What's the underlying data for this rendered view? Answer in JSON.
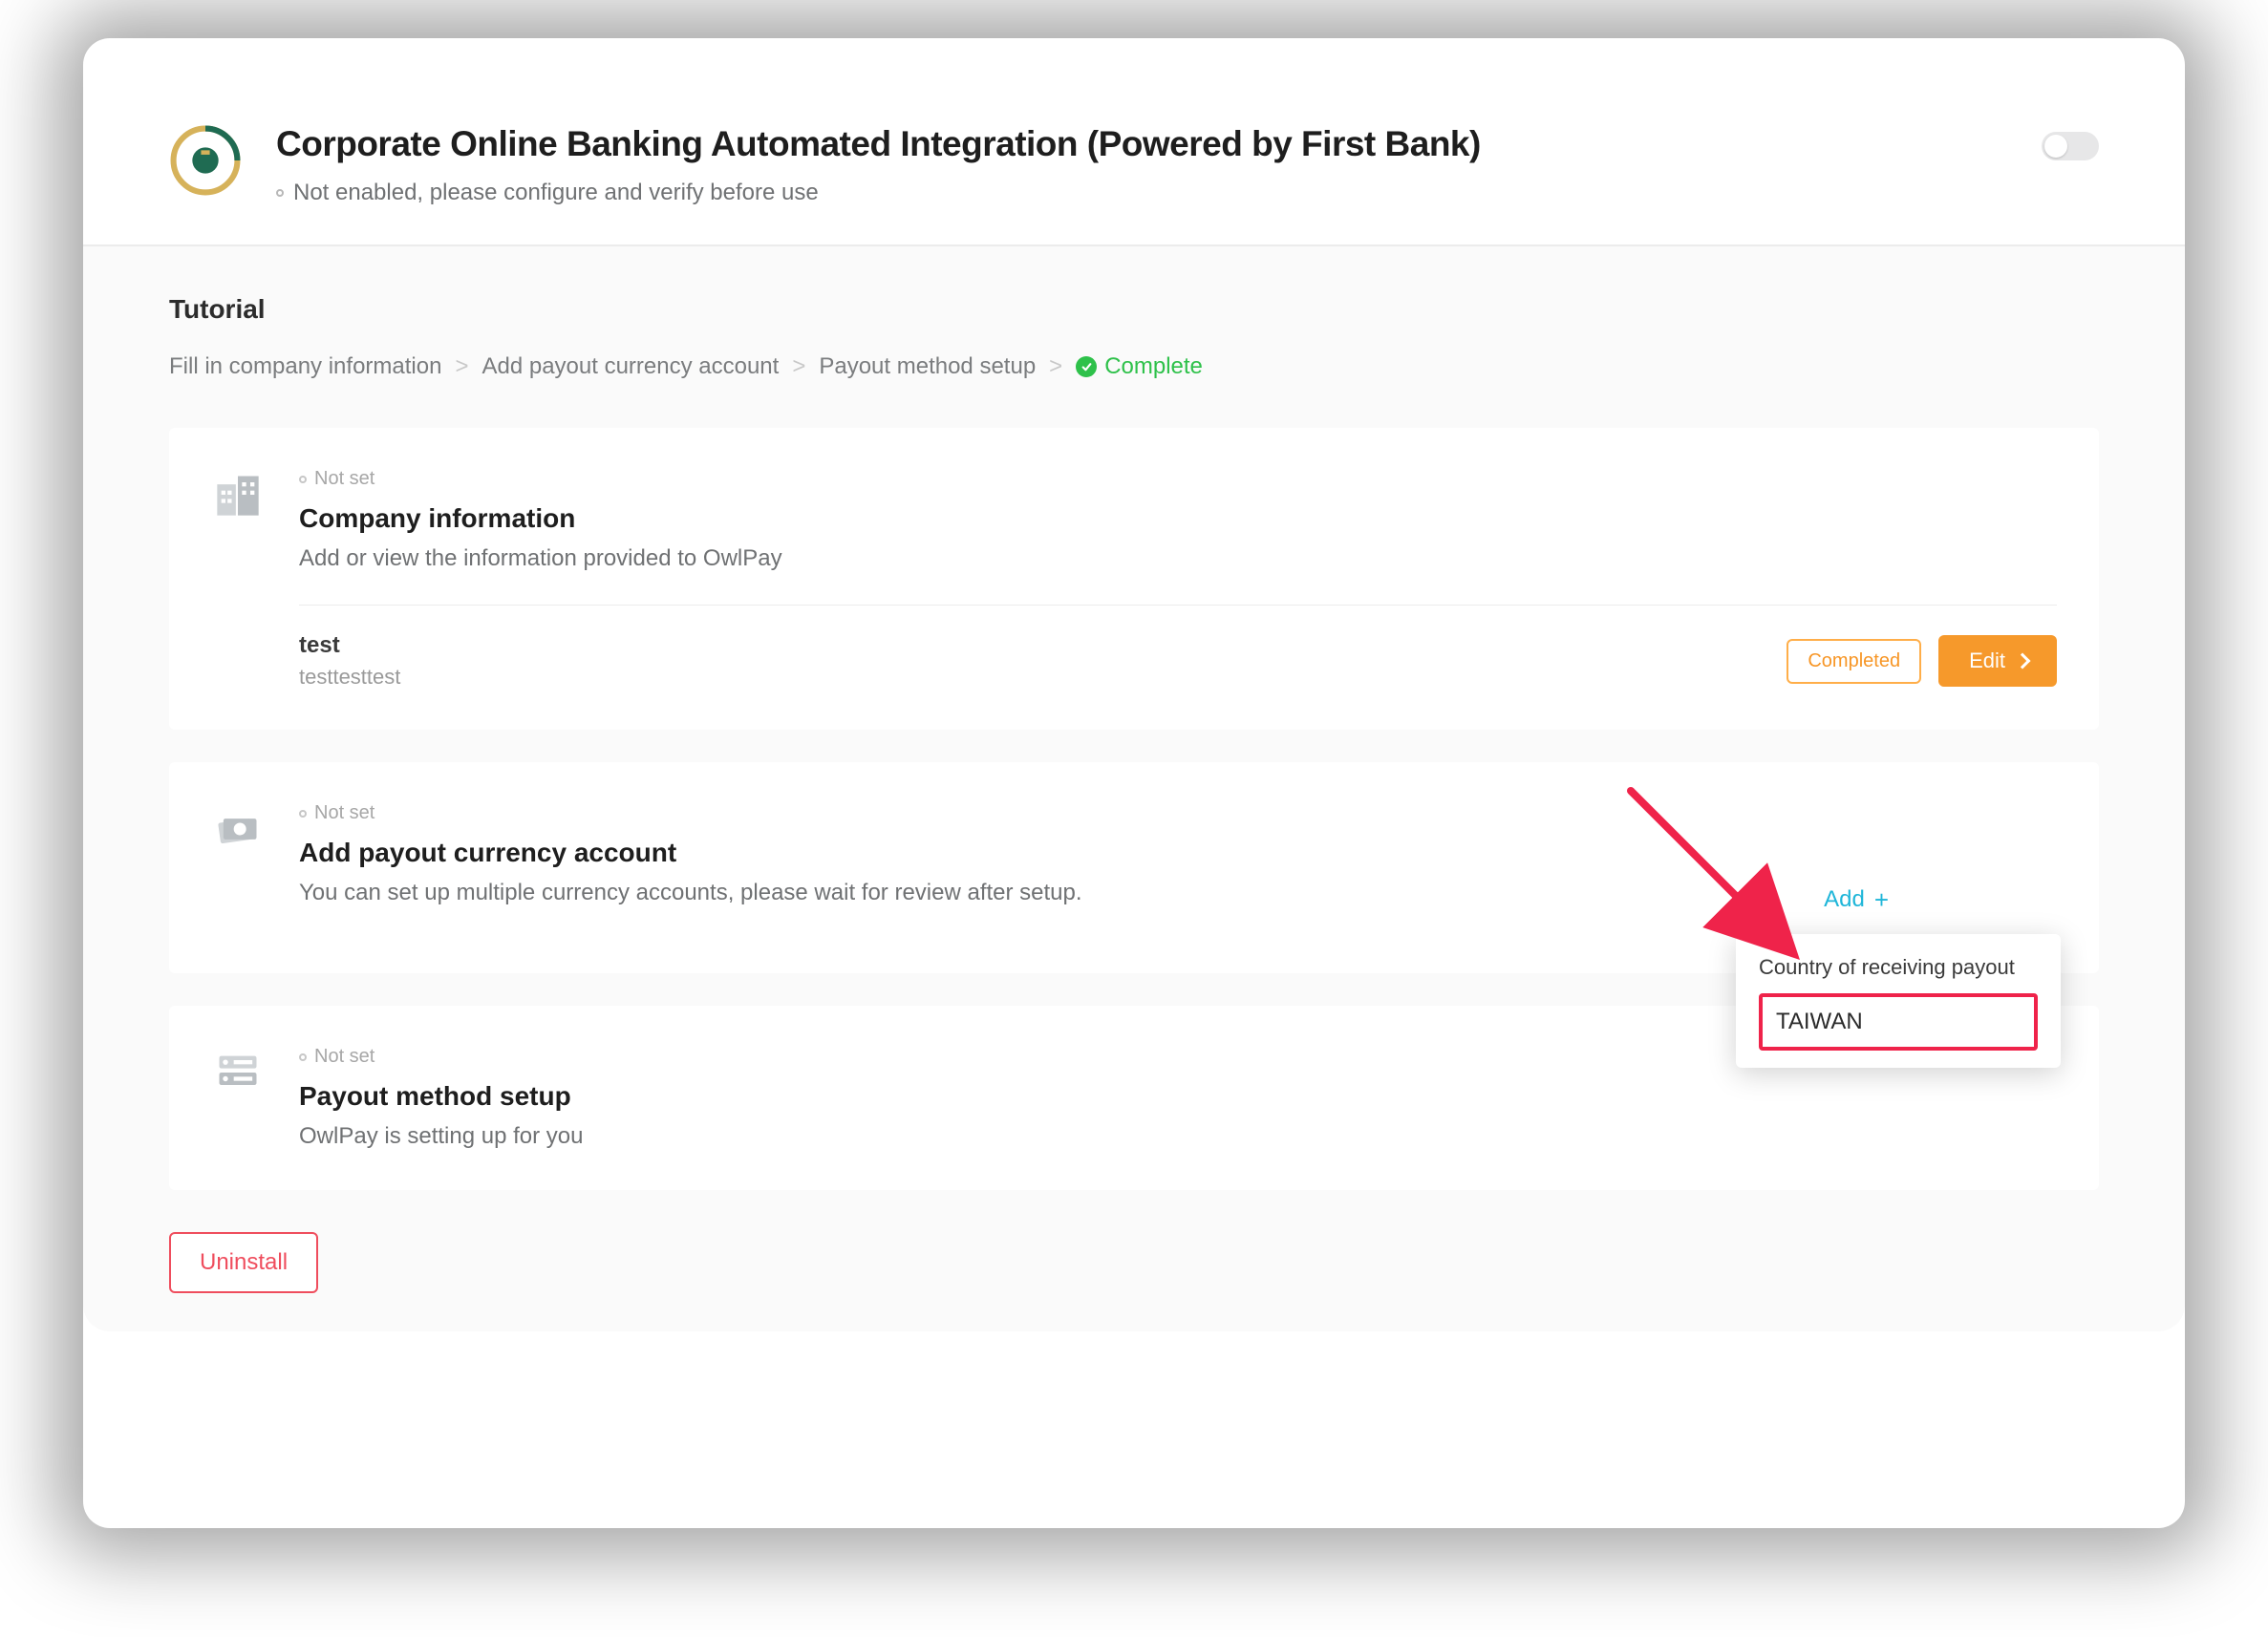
{
  "header": {
    "title": "Corporate Online Banking Automated Integration (Powered by First Bank)",
    "subtitle": "Not enabled, please configure and verify before use",
    "toggle_on": false
  },
  "tutorial": {
    "label": "Tutorial",
    "steps": [
      "Fill in company information",
      "Add payout currency account",
      "Payout method setup"
    ],
    "complete_label": "Complete"
  },
  "cards": {
    "company": {
      "status": "Not set",
      "title": "Company information",
      "desc": "Add or view the information provided to OwlPay",
      "entry_name": "test",
      "entry_detail": "testtesttest",
      "badge": "Completed",
      "edit_label": "Edit"
    },
    "payout_account": {
      "status": "Not set",
      "title": "Add payout currency account",
      "desc": "You can set up multiple currency accounts, please wait for review after setup.",
      "add_label": "Add",
      "dropdown_label": "Country of receiving payout",
      "dropdown_item": "TAIWAN"
    },
    "payout_method": {
      "status": "Not set",
      "title": "Payout method setup",
      "desc": "OwlPay is setting up for you"
    }
  },
  "uninstall_label": "Uninstall",
  "colors": {
    "accent_green": "#2ec14a",
    "accent_orange": "#f6992b",
    "accent_cyan": "#1fb6d9",
    "danger": "#ef4d5d",
    "highlight_red": "#ef234a"
  }
}
